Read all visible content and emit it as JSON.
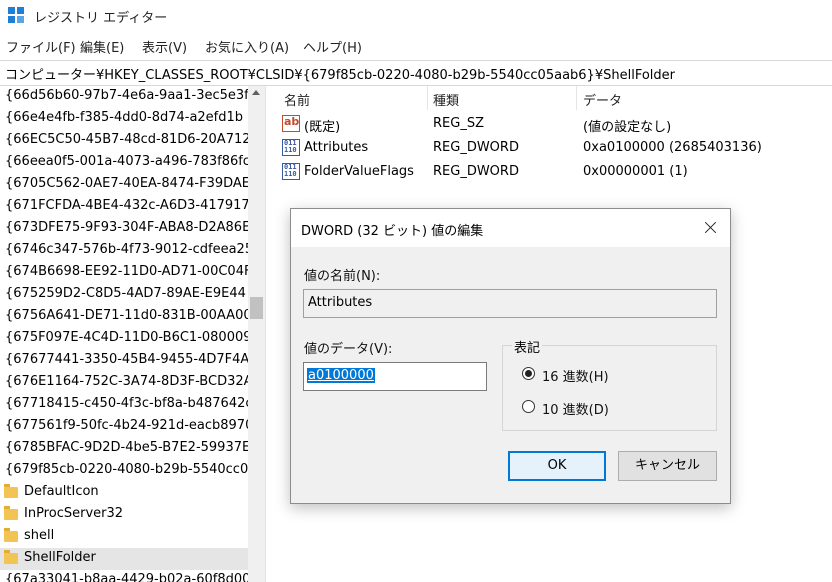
{
  "window": {
    "title": "レジストリ エディター"
  },
  "menu": [
    "ファイル(F)",
    "編集(E)",
    "表示(V)",
    "お気に入り(A)",
    "ヘルプ(H)"
  ],
  "address": "コンピューター¥HKEY_CLASSES_ROOT¥CLSID¥{679f85cb-0220-4080-b29b-5540cc05aab6}¥ShellFolder",
  "tree": {
    "keys": [
      "{66d56b60-97b7-4e6a-9aa1-3ec5e3f",
      "{66e4e4fb-f385-4dd0-8d74-a2efd1b",
      "{66EC5C50-45B7-48cd-81D6-20A712",
      "{66eea0f5-001a-4073-a496-783f86fc",
      "{6705C562-0AE7-40EA-8474-F39DAE",
      "{671FCFDA-4BE4-432c-A6D3-417917",
      "{673DFE75-9F93-304F-ABA8-D2A86E",
      "{6746c347-576b-4f73-9012-cdfeea25",
      "{674B6698-EE92-11D0-AD71-00C04F",
      "{675259D2-C8D5-4AD7-89AE-E9E44",
      "{6756A641-DE71-11d0-831B-00AA00",
      "{675F097E-4C4D-11D0-B6C1-080009",
      "{67677441-3350-45B4-9455-4D7F4A",
      "{676E1164-752C-3A74-8D3F-BCD32A",
      "{67718415-c450-4f3c-bf8a-b487642c",
      "{677561f9-50fc-4b24-921d-eacb8970",
      "{6785BFAC-9D2D-4be5-B7E2-59937E",
      "{679f85cb-0220-4080-b29b-5540cc0"
    ],
    "subkeys": [
      "DefaultIcon",
      "InProcServer32",
      "shell",
      "ShellFolder"
    ],
    "last": "{67a33041-b8aa-4429-b02a-60f8d00"
  },
  "list": {
    "headers": {
      "name": "名前",
      "type": "種類",
      "data": "データ"
    },
    "rows": [
      {
        "name": "(既定)",
        "type": "REG_SZ",
        "data": "(値の設定なし)",
        "icon": "string-value-icon"
      },
      {
        "name": "Attributes",
        "type": "REG_DWORD",
        "data": "0xa0100000 (2685403136)",
        "icon": "binary-value-icon"
      },
      {
        "name": "FolderValueFlags",
        "type": "REG_DWORD",
        "data": "0x00000001 (1)",
        "icon": "binary-value-icon"
      }
    ]
  },
  "dialog": {
    "title": "DWORD (32 ビット) 値の編集",
    "name_label": "値の名前(N):",
    "name_value": "Attributes",
    "data_label": "値のデータ(V):",
    "data_value": "a0100000",
    "base_label": "表記",
    "hex_label": "16 進数(H)",
    "dec_label": "10 進数(D)",
    "base_selected": "hex",
    "ok_label": "OK",
    "cancel_label": "キャンセル"
  }
}
